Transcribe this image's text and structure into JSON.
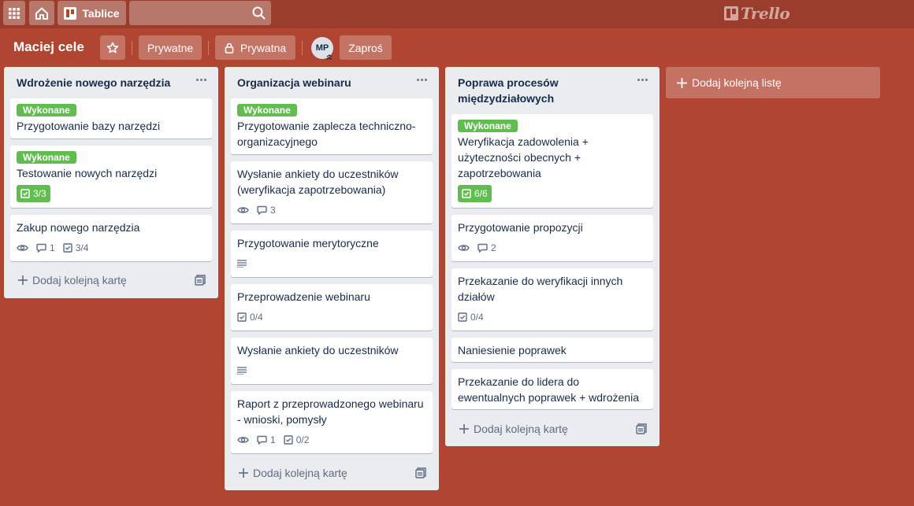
{
  "header": {
    "boards_label": "Tablice",
    "search_value": "",
    "logo_text": "Trello"
  },
  "board": {
    "title": "Maciej cele",
    "team_label": "Prywatne",
    "privacy_label": "Prywatna",
    "avatar_initials": "MP",
    "invite_label": "Zaproś"
  },
  "lists": [
    {
      "title": "Wdrożenie nowego narzędzia",
      "add_card_label": "Dodaj kolejną kartę",
      "cards": [
        {
          "label": "Wykonane",
          "title": "Przygotowanie bazy narzędzi"
        },
        {
          "label": "Wykonane",
          "title": "Testowanie nowych narzędzi",
          "checklist": "3/3"
        },
        {
          "title": "Zakup nowego narzędzia",
          "comments": "1",
          "checklist": "3/4"
        }
      ]
    },
    {
      "title": "Organizacja webinaru",
      "add_card_label": "Dodaj kolejną kartę",
      "cards": [
        {
          "label": "Wykonane",
          "title": "Przygotowanie zaplecza techniczno-organizacyjnego"
        },
        {
          "title": "Wysłanie ankiety do uczestników (weryfikacja zapotrzebowania)",
          "comments": "3"
        },
        {
          "title": "Przygotowanie merytoryczne"
        },
        {
          "title": "Przeprowadzenie webinaru",
          "checklist": "0/4"
        },
        {
          "title": "Wysłanie ankiety do uczestników"
        },
        {
          "title": "Raport z przeprowadzonego webinaru - wnioski, pomysły",
          "comments": "1",
          "checklist": "0/2"
        }
      ]
    },
    {
      "title": "Poprawa procesów międzydziałowych",
      "add_card_label": "Dodaj kolejną kartę",
      "cards": [
        {
          "label": "Wykonane",
          "title": "Weryfikacja zadowolenia + użyteczności obecnych + zapotrzebowania",
          "checklist": "6/6"
        },
        {
          "title": "Przygotowanie propozycji",
          "comments": "2"
        },
        {
          "title": "Przekazanie do weryfikacji innych działów",
          "checklist": "0/4"
        },
        {
          "title": "Naniesienie poprawek"
        },
        {
          "title": "Przekazanie do lidera do ewentualnych poprawek + wdrożenia"
        }
      ]
    }
  ],
  "add_list_label": "Dodaj kolejną listę",
  "colors": {
    "board_background": "#b04632",
    "label_green": "#61bd4f",
    "list_background": "#ebecf0"
  },
  "icons": [
    "apps-icon",
    "home-icon",
    "boards-icon",
    "search-icon",
    "star-icon",
    "lock-icon",
    "watch-icon",
    "comment-icon",
    "checklist-icon",
    "description-icon",
    "plus-icon",
    "template-icon"
  ]
}
